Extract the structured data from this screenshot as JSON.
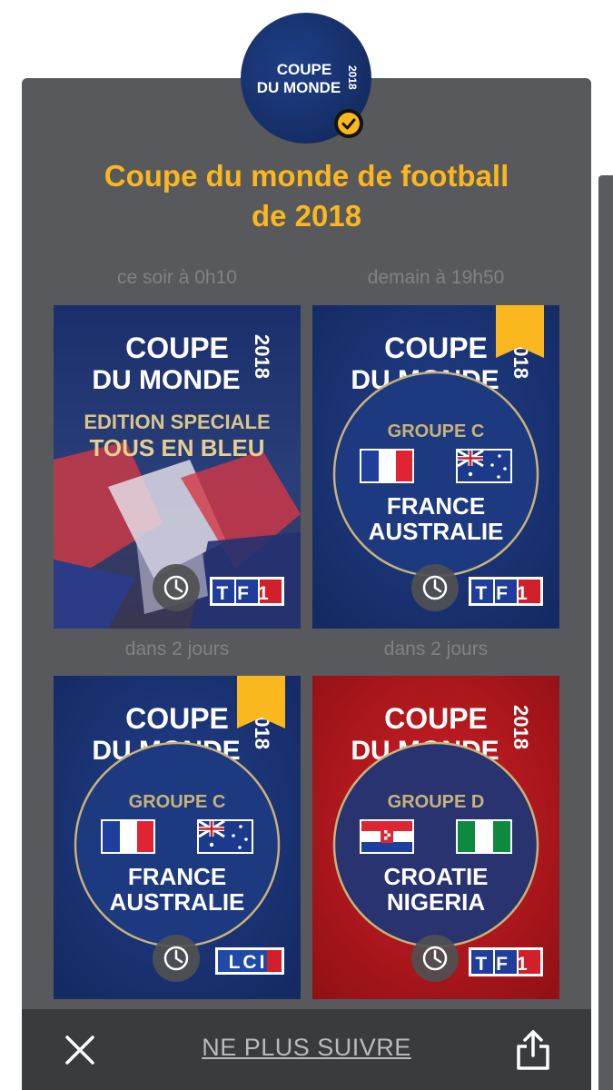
{
  "header": {
    "logo_line1": "COUPE",
    "logo_line2": "DU MONDE",
    "logo_year": "2018",
    "verified_icon": "check-circle-icon",
    "title_line1": "Coupe du monde de football",
    "title_line2": "de 2018"
  },
  "programs": [
    {
      "time": "ce soir à 0h10",
      "logo_line1": "COUPE",
      "logo_line2": "DU MONDE",
      "logo_year": "2018",
      "headline1": "EDITION SPECIALE",
      "headline2": "TOUS EN BLEU",
      "channel": "TF1",
      "bookmarked": false
    },
    {
      "time": "demain à 19h50",
      "logo_line1": "COUPE",
      "logo_line2": "DU MONDE",
      "logo_year": "2018",
      "group": "GROUPE C",
      "team1": "FRANCE",
      "team2": "AUSTRALIE",
      "channel": "TF1",
      "bookmarked": true
    },
    {
      "time": "dans 2 jours",
      "logo_line1": "COUPE",
      "logo_line2": "DU MONDE",
      "logo_year": "2018",
      "group": "GROUPE C",
      "team1": "FRANCE",
      "team2": "AUSTRALIE",
      "channel": "LCI",
      "bookmarked": true
    },
    {
      "time": "dans 2 jours",
      "logo_line1": "COUPE",
      "logo_line2": "DU MONDE",
      "logo_year": "2018",
      "group": "GROUPE D",
      "team1": "CROATIE",
      "team2": "NIGERIA",
      "channel": "TF1",
      "bookmarked": false
    }
  ],
  "footer": {
    "close_icon": "close-icon",
    "unfollow_label": "NE PLUS SUIVRE",
    "share_icon": "share-icon"
  },
  "colors": {
    "accent": "#fbb71e",
    "panel": "#58595c",
    "bar": "#3a3b3d",
    "card_blue": "#1a3578",
    "card_red": "#b5161b"
  }
}
